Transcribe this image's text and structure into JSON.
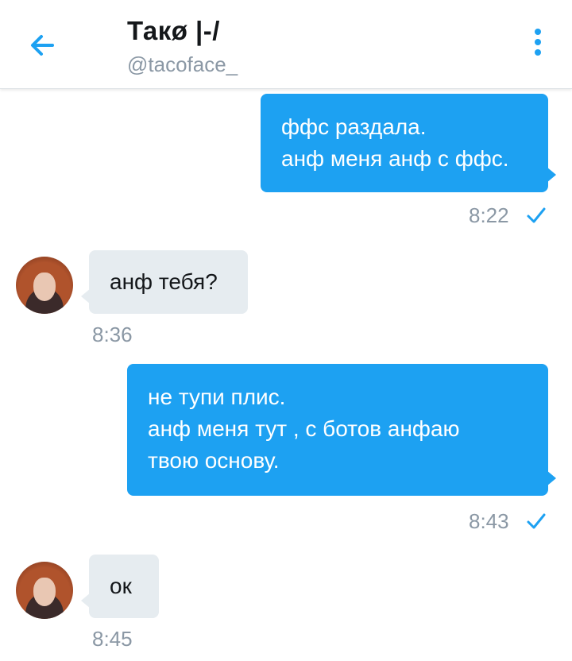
{
  "header": {
    "title": "Такø |-/",
    "handle": "@tacoface_",
    "back_icon": "arrow-left-icon",
    "more_icon": "more-vertical-icon"
  },
  "colors": {
    "accent": "#1da1f2",
    "incoming_bubble": "#e6ecf0",
    "timestamp": "#8b98a5"
  },
  "messages": [
    {
      "direction": "out",
      "lines": [
        "ффс раздала.",
        "анф меня анф с ффс."
      ],
      "time": "8:22",
      "status": "sent-check-icon"
    },
    {
      "direction": "in",
      "lines": [
        "анф тебя?"
      ],
      "time": "8:36",
      "avatar": "avatar-icon"
    },
    {
      "direction": "out",
      "lines": [
        "не тупи плис.",
        "анф меня тут , с ботов анфаю",
        "твою основу."
      ],
      "time": "8:43",
      "status": "sent-check-icon"
    },
    {
      "direction": "in",
      "lines": [
        "ок"
      ],
      "time": "8:45",
      "avatar": "avatar-icon"
    }
  ]
}
